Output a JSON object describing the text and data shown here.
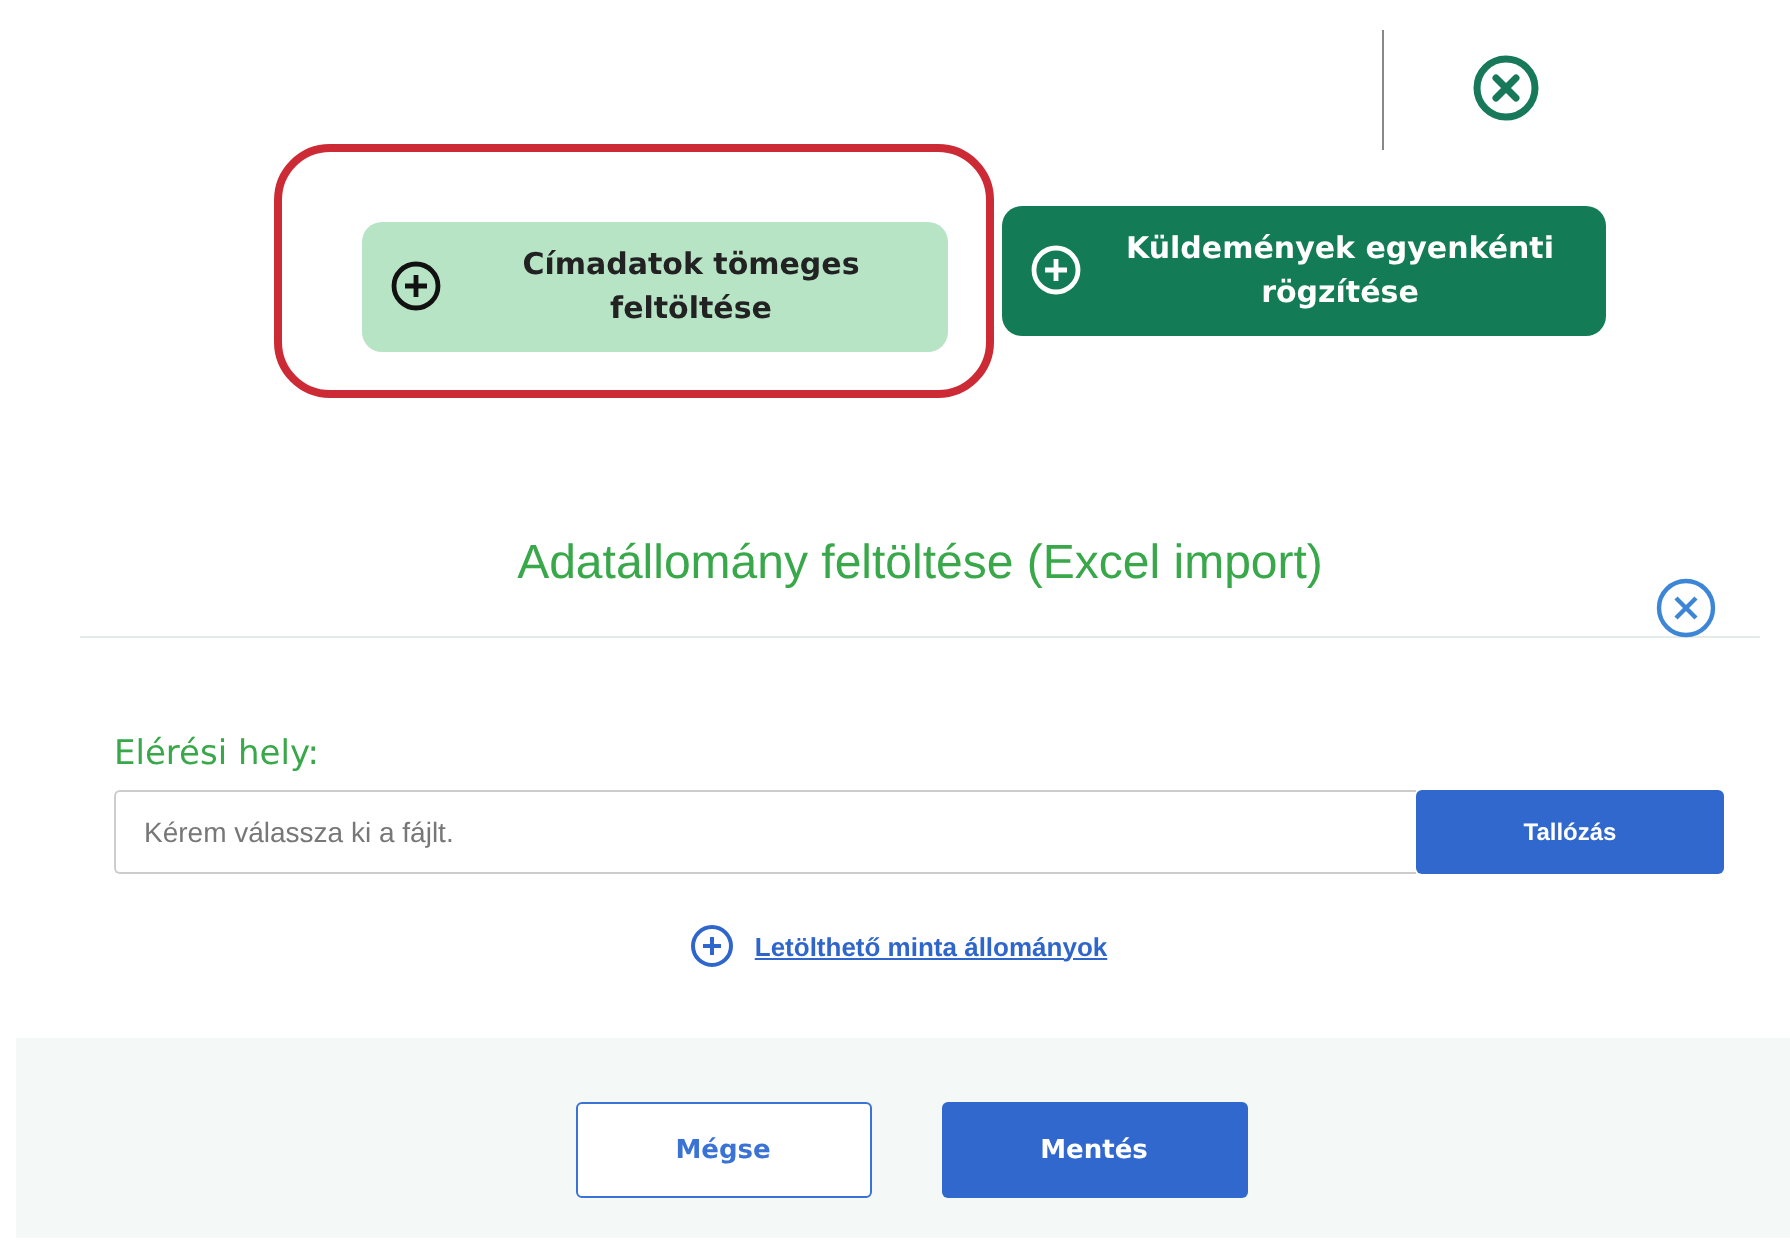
{
  "top_buttons": [
    {
      "label": "Címadatok tömeges feltöltése",
      "selected": true
    },
    {
      "label": "Küldemények egyenkénti rögzítése",
      "selected": false
    }
  ],
  "dialog": {
    "title": "Adatállomány feltöltése (Excel import)",
    "field_label": "Elérési hely:",
    "file_field": {
      "placeholder": "Kérem válassza ki a fájlt."
    },
    "browse_button": "Tallózás",
    "sample_link": "Letölthető minta állományok"
  },
  "footer_buttons": [
    {
      "label": "Mégse",
      "kind": "secondary"
    },
    {
      "label": "Mentés",
      "kind": "primary"
    }
  ]
}
